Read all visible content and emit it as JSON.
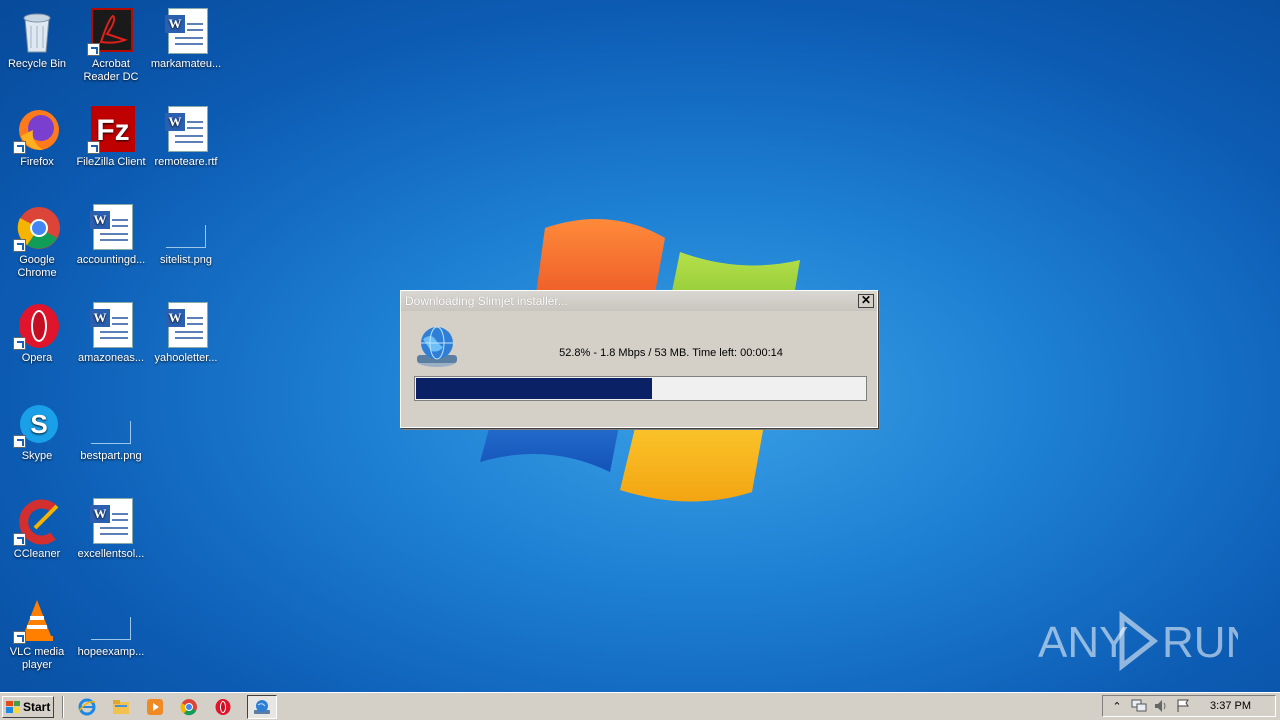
{
  "desktop": {
    "icons": [
      {
        "label": "Recycle Bin",
        "icon": "recycle-bin-icon"
      },
      {
        "label": "Acrobat Reader DC",
        "icon": "acrobat-icon"
      },
      {
        "label": "markamateu...",
        "icon": "word-doc-icon"
      },
      {
        "label": "Firefox",
        "icon": "firefox-icon"
      },
      {
        "label": "FileZilla Client",
        "icon": "filezilla-icon"
      },
      {
        "label": "remoteare.rtf",
        "icon": "word-doc-icon"
      },
      {
        "label": "Google Chrome",
        "icon": "chrome-icon"
      },
      {
        "label": "accountingd...",
        "icon": "word-doc-icon"
      },
      {
        "label": "sitelist.png",
        "icon": "png-file-icon"
      },
      {
        "label": "Opera",
        "icon": "opera-icon"
      },
      {
        "label": "amazoneas...",
        "icon": "word-doc-icon"
      },
      {
        "label": "yahooletter...",
        "icon": "word-doc-icon"
      },
      {
        "label": "Skype",
        "icon": "skype-icon"
      },
      {
        "label": "bestpart.png",
        "icon": "png-file-icon"
      },
      {
        "label": "CCleaner",
        "icon": "ccleaner-icon"
      },
      {
        "label": "excellentsol...",
        "icon": "word-doc-icon"
      },
      {
        "label": "VLC media player",
        "icon": "vlc-icon"
      },
      {
        "label": "hopeexamp...",
        "icon": "png-file-icon"
      }
    ]
  },
  "dialog": {
    "title": "Downloading Slimjet installer...",
    "status": "52.8% - 1.8 Mbps / 53 MB. Time left: 00:00:14",
    "progress": 0.528,
    "progress_color": "#0b2166"
  },
  "taskbar": {
    "start_label": "Start",
    "apps": [
      "internet-explorer-icon",
      "explorer-folder-icon",
      "media-player-icon",
      "chrome-icon",
      "opera-icon",
      "installer-icon"
    ],
    "clock": "3:37 PM"
  },
  "watermark": {
    "text_left": "ANY",
    "text_right": "RUN"
  }
}
